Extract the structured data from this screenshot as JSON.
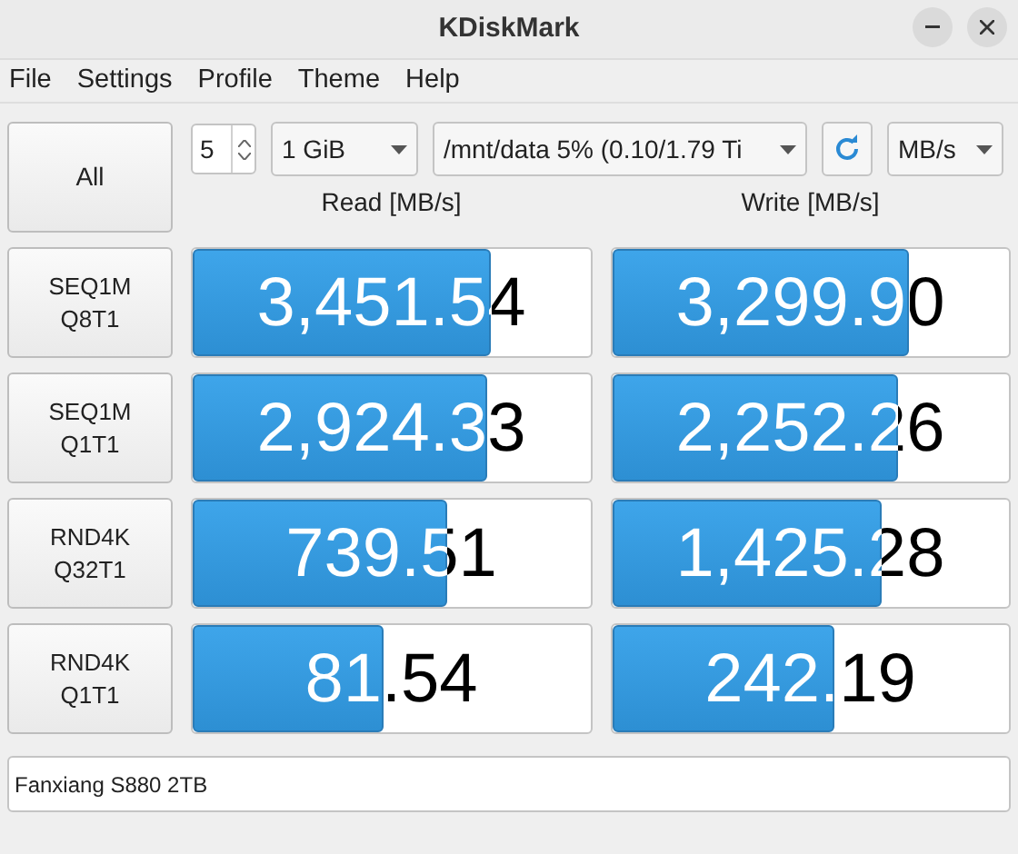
{
  "window": {
    "title": "KDiskMark"
  },
  "menu": [
    "File",
    "Settings",
    "Profile",
    "Theme",
    "Help"
  ],
  "toolbar": {
    "all_button": "All",
    "runs": "5",
    "size": "1 GiB",
    "target": "/mnt/data 5% (0.10/1.79 Ti",
    "units": "MB/s"
  },
  "columns": [
    "Read [MB/s]",
    "Write [MB/s]"
  ],
  "tests": [
    {
      "name": "SEQ1M\nQ8T1",
      "read": {
        "value": "3,451.54",
        "level": 0.75
      },
      "write": {
        "value": "3,299.90",
        "level": 0.75
      }
    },
    {
      "name": "SEQ1M\nQ1T1",
      "read": {
        "value": "2,924.33",
        "level": 0.74
      },
      "write": {
        "value": "2,252.26",
        "level": 0.72
      }
    },
    {
      "name": "RND4K\nQ32T1",
      "read": {
        "value": "739.51",
        "level": 0.64
      },
      "write": {
        "value": "1,425.28",
        "level": 0.68
      }
    },
    {
      "name": "RND4K\nQ1T1",
      "read": {
        "value": "81.54",
        "level": 0.48
      },
      "write": {
        "value": "242.19",
        "level": 0.56
      }
    }
  ],
  "comment": {
    "value": "Fanxiang S880 2TB"
  }
}
